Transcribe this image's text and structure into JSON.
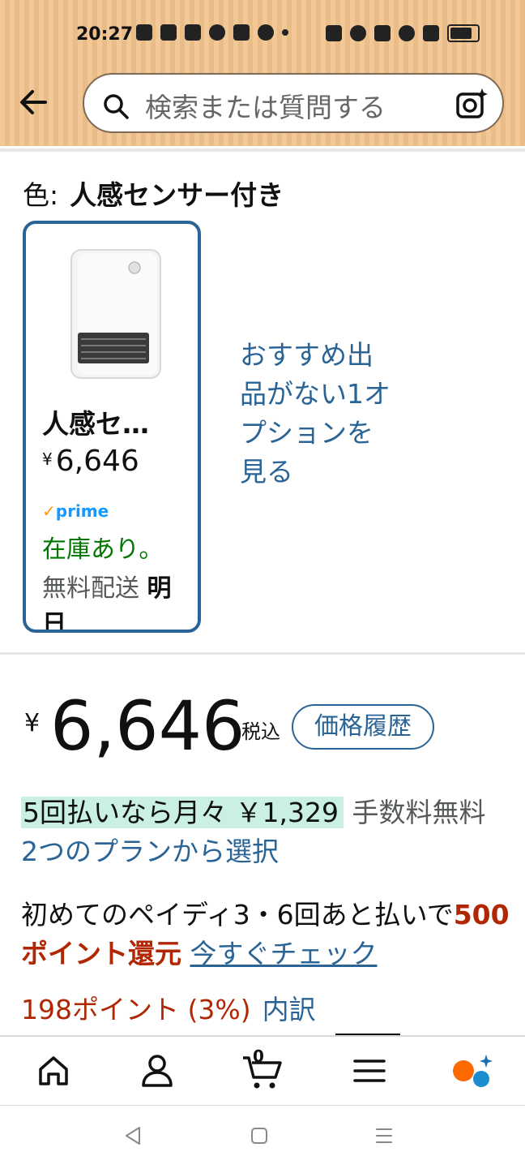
{
  "status_bar": {
    "time": "20:27"
  },
  "search": {
    "placeholder": "検索または質問する"
  },
  "variant": {
    "label": "色:",
    "value": "人感センサー付き"
  },
  "option_card": {
    "name": "人感セ…",
    "price_symbol": "¥",
    "price": "6,646",
    "prime": "prime",
    "stock": "在庫あり。",
    "shipping": "無料配送",
    "shipping_day": "明",
    "shipping_day_2": "日"
  },
  "see_options": "おすすめ出品がない1オプションを見る",
  "price": {
    "symbol": "¥",
    "amount": "6,646",
    "tax": "税込",
    "history_button": "価格履歴"
  },
  "installment": {
    "highlight": "5回払いなら月々 ￥1,329",
    "fee": "手数料無料",
    "plans_link": "2つのプランから選択"
  },
  "paidy": {
    "text": "初めてのペイディ3・6回あと払いで",
    "points": "500ポイント還元",
    "link": "今すぐチェック"
  },
  "points": {
    "earned": "198ポイント (3%)",
    "breakdown": "内訳"
  },
  "bottom_nav": {
    "cart_count": "0"
  }
}
